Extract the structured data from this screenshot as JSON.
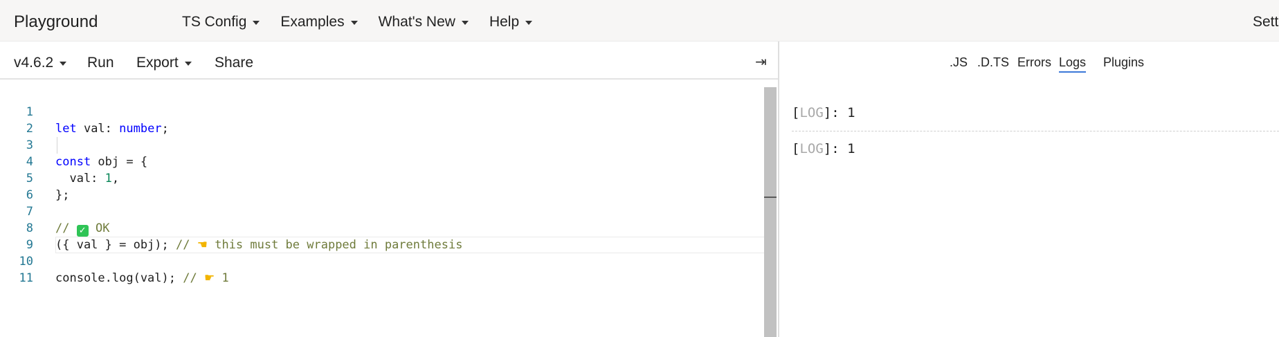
{
  "app": {
    "title": "Playground"
  },
  "nav": {
    "items": [
      {
        "label": "TS Config"
      },
      {
        "label": "Examples"
      },
      {
        "label": "What's New"
      },
      {
        "label": "Help"
      }
    ],
    "right_label": "Sett"
  },
  "toolbar": {
    "version": "v4.6.2",
    "run": "Run",
    "export": "Export",
    "share": "Share",
    "collapse_glyph": "⇥"
  },
  "editor": {
    "lines": [
      {
        "n": "1"
      },
      {
        "n": "2"
      },
      {
        "n": "3"
      },
      {
        "n": "4"
      },
      {
        "n": "5"
      },
      {
        "n": "6"
      },
      {
        "n": "7"
      },
      {
        "n": "8"
      },
      {
        "n": "9"
      },
      {
        "n": "10"
      },
      {
        "n": "11"
      }
    ],
    "tokens": {
      "l1_kw": "let",
      "l1_mid": " val: ",
      "l1_type": "number",
      "l1_end": ";",
      "l3_kw": "const",
      "l3_rest": " obj = {",
      "l4_a": "  val: ",
      "l4_num": "1",
      "l4_end": ",",
      "l5": "};",
      "l7_a": "// ",
      "l7_check": "✓",
      "l7_b": " OK",
      "l8_code": "({ val } = obj); ",
      "l8_cm_a": "// ",
      "l8_hand": "☚",
      "l8_cm_b": " this must be wrapped in parenthesis",
      "l10_code": "console.log(val); ",
      "l10_cm_a": "// ",
      "l10_hand": "☛",
      "l10_cm_b": " 1"
    }
  },
  "output": {
    "tabs": [
      {
        "label": ".JS"
      },
      {
        "label": ".D.TS"
      },
      {
        "label": "Errors"
      },
      {
        "label": "Logs"
      },
      {
        "label": "Plugins"
      }
    ],
    "logs": [
      {
        "open": "[",
        "tag": "LOG",
        "close": "]: ",
        "value": "1"
      },
      {
        "open": "[",
        "tag": "LOG",
        "close": "]: ",
        "value": "1"
      }
    ]
  },
  "colors": {
    "accent": "#3b78d8",
    "keyword": "#0000ff",
    "number": "#098658",
    "comment": "#6f7b3b",
    "line_number": "#237893"
  }
}
